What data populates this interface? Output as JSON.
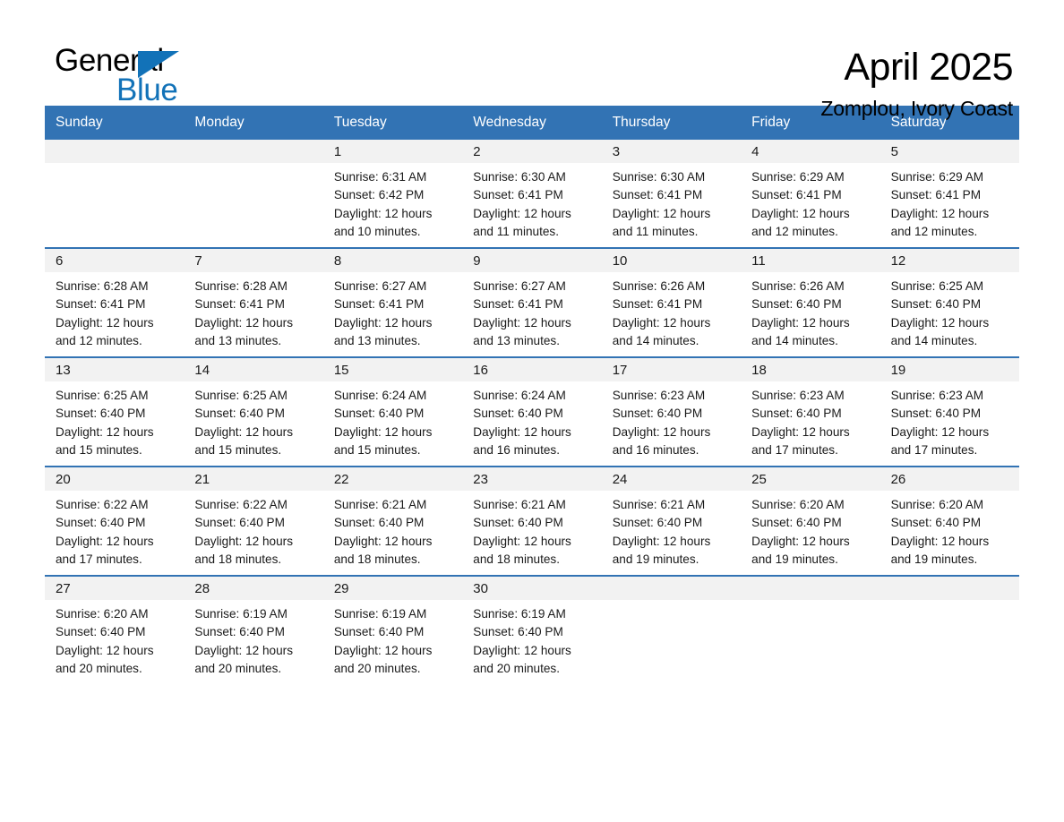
{
  "brand": {
    "name_part1": "General",
    "name_part2": "Blue",
    "logo_icon": "triangle-logo-icon",
    "accent_color": "#1272b8"
  },
  "header": {
    "month_title": "April 2025",
    "location": "Zomplou, Ivory Coast"
  },
  "theme": {
    "header_blue": "#3273b4",
    "daynum_band": "#f2f2f2",
    "text_color": "#1a1a1a"
  },
  "weekdays": [
    "Sunday",
    "Monday",
    "Tuesday",
    "Wednesday",
    "Thursday",
    "Friday",
    "Saturday"
  ],
  "weeks": [
    {
      "days": [
        {
          "daynum": "",
          "sunrise": "",
          "sunset": "",
          "daylight_line1": "",
          "daylight_line2": "",
          "empty": true
        },
        {
          "daynum": "",
          "sunrise": "",
          "sunset": "",
          "daylight_line1": "",
          "daylight_line2": "",
          "empty": true
        },
        {
          "daynum": "1",
          "sunrise": "Sunrise: 6:31 AM",
          "sunset": "Sunset: 6:42 PM",
          "daylight_line1": "Daylight: 12 hours",
          "daylight_line2": "and 10 minutes.",
          "empty": false
        },
        {
          "daynum": "2",
          "sunrise": "Sunrise: 6:30 AM",
          "sunset": "Sunset: 6:41 PM",
          "daylight_line1": "Daylight: 12 hours",
          "daylight_line2": "and 11 minutes.",
          "empty": false
        },
        {
          "daynum": "3",
          "sunrise": "Sunrise: 6:30 AM",
          "sunset": "Sunset: 6:41 PM",
          "daylight_line1": "Daylight: 12 hours",
          "daylight_line2": "and 11 minutes.",
          "empty": false
        },
        {
          "daynum": "4",
          "sunrise": "Sunrise: 6:29 AM",
          "sunset": "Sunset: 6:41 PM",
          "daylight_line1": "Daylight: 12 hours",
          "daylight_line2": "and 12 minutes.",
          "empty": false
        },
        {
          "daynum": "5",
          "sunrise": "Sunrise: 6:29 AM",
          "sunset": "Sunset: 6:41 PM",
          "daylight_line1": "Daylight: 12 hours",
          "daylight_line2": "and 12 minutes.",
          "empty": false
        }
      ]
    },
    {
      "days": [
        {
          "daynum": "6",
          "sunrise": "Sunrise: 6:28 AM",
          "sunset": "Sunset: 6:41 PM",
          "daylight_line1": "Daylight: 12 hours",
          "daylight_line2": "and 12 minutes.",
          "empty": false
        },
        {
          "daynum": "7",
          "sunrise": "Sunrise: 6:28 AM",
          "sunset": "Sunset: 6:41 PM",
          "daylight_line1": "Daylight: 12 hours",
          "daylight_line2": "and 13 minutes.",
          "empty": false
        },
        {
          "daynum": "8",
          "sunrise": "Sunrise: 6:27 AM",
          "sunset": "Sunset: 6:41 PM",
          "daylight_line1": "Daylight: 12 hours",
          "daylight_line2": "and 13 minutes.",
          "empty": false
        },
        {
          "daynum": "9",
          "sunrise": "Sunrise: 6:27 AM",
          "sunset": "Sunset: 6:41 PM",
          "daylight_line1": "Daylight: 12 hours",
          "daylight_line2": "and 13 minutes.",
          "empty": false
        },
        {
          "daynum": "10",
          "sunrise": "Sunrise: 6:26 AM",
          "sunset": "Sunset: 6:41 PM",
          "daylight_line1": "Daylight: 12 hours",
          "daylight_line2": "and 14 minutes.",
          "empty": false
        },
        {
          "daynum": "11",
          "sunrise": "Sunrise: 6:26 AM",
          "sunset": "Sunset: 6:40 PM",
          "daylight_line1": "Daylight: 12 hours",
          "daylight_line2": "and 14 minutes.",
          "empty": false
        },
        {
          "daynum": "12",
          "sunrise": "Sunrise: 6:25 AM",
          "sunset": "Sunset: 6:40 PM",
          "daylight_line1": "Daylight: 12 hours",
          "daylight_line2": "and 14 minutes.",
          "empty": false
        }
      ]
    },
    {
      "days": [
        {
          "daynum": "13",
          "sunrise": "Sunrise: 6:25 AM",
          "sunset": "Sunset: 6:40 PM",
          "daylight_line1": "Daylight: 12 hours",
          "daylight_line2": "and 15 minutes.",
          "empty": false
        },
        {
          "daynum": "14",
          "sunrise": "Sunrise: 6:25 AM",
          "sunset": "Sunset: 6:40 PM",
          "daylight_line1": "Daylight: 12 hours",
          "daylight_line2": "and 15 minutes.",
          "empty": false
        },
        {
          "daynum": "15",
          "sunrise": "Sunrise: 6:24 AM",
          "sunset": "Sunset: 6:40 PM",
          "daylight_line1": "Daylight: 12 hours",
          "daylight_line2": "and 15 minutes.",
          "empty": false
        },
        {
          "daynum": "16",
          "sunrise": "Sunrise: 6:24 AM",
          "sunset": "Sunset: 6:40 PM",
          "daylight_line1": "Daylight: 12 hours",
          "daylight_line2": "and 16 minutes.",
          "empty": false
        },
        {
          "daynum": "17",
          "sunrise": "Sunrise: 6:23 AM",
          "sunset": "Sunset: 6:40 PM",
          "daylight_line1": "Daylight: 12 hours",
          "daylight_line2": "and 16 minutes.",
          "empty": false
        },
        {
          "daynum": "18",
          "sunrise": "Sunrise: 6:23 AM",
          "sunset": "Sunset: 6:40 PM",
          "daylight_line1": "Daylight: 12 hours",
          "daylight_line2": "and 17 minutes.",
          "empty": false
        },
        {
          "daynum": "19",
          "sunrise": "Sunrise: 6:23 AM",
          "sunset": "Sunset: 6:40 PM",
          "daylight_line1": "Daylight: 12 hours",
          "daylight_line2": "and 17 minutes.",
          "empty": false
        }
      ]
    },
    {
      "days": [
        {
          "daynum": "20",
          "sunrise": "Sunrise: 6:22 AM",
          "sunset": "Sunset: 6:40 PM",
          "daylight_line1": "Daylight: 12 hours",
          "daylight_line2": "and 17 minutes.",
          "empty": false
        },
        {
          "daynum": "21",
          "sunrise": "Sunrise: 6:22 AM",
          "sunset": "Sunset: 6:40 PM",
          "daylight_line1": "Daylight: 12 hours",
          "daylight_line2": "and 18 minutes.",
          "empty": false
        },
        {
          "daynum": "22",
          "sunrise": "Sunrise: 6:21 AM",
          "sunset": "Sunset: 6:40 PM",
          "daylight_line1": "Daylight: 12 hours",
          "daylight_line2": "and 18 minutes.",
          "empty": false
        },
        {
          "daynum": "23",
          "sunrise": "Sunrise: 6:21 AM",
          "sunset": "Sunset: 6:40 PM",
          "daylight_line1": "Daylight: 12 hours",
          "daylight_line2": "and 18 minutes.",
          "empty": false
        },
        {
          "daynum": "24",
          "sunrise": "Sunrise: 6:21 AM",
          "sunset": "Sunset: 6:40 PM",
          "daylight_line1": "Daylight: 12 hours",
          "daylight_line2": "and 19 minutes.",
          "empty": false
        },
        {
          "daynum": "25",
          "sunrise": "Sunrise: 6:20 AM",
          "sunset": "Sunset: 6:40 PM",
          "daylight_line1": "Daylight: 12 hours",
          "daylight_line2": "and 19 minutes.",
          "empty": false
        },
        {
          "daynum": "26",
          "sunrise": "Sunrise: 6:20 AM",
          "sunset": "Sunset: 6:40 PM",
          "daylight_line1": "Daylight: 12 hours",
          "daylight_line2": "and 19 minutes.",
          "empty": false
        }
      ]
    },
    {
      "days": [
        {
          "daynum": "27",
          "sunrise": "Sunrise: 6:20 AM",
          "sunset": "Sunset: 6:40 PM",
          "daylight_line1": "Daylight: 12 hours",
          "daylight_line2": "and 20 minutes.",
          "empty": false
        },
        {
          "daynum": "28",
          "sunrise": "Sunrise: 6:19 AM",
          "sunset": "Sunset: 6:40 PM",
          "daylight_line1": "Daylight: 12 hours",
          "daylight_line2": "and 20 minutes.",
          "empty": false
        },
        {
          "daynum": "29",
          "sunrise": "Sunrise: 6:19 AM",
          "sunset": "Sunset: 6:40 PM",
          "daylight_line1": "Daylight: 12 hours",
          "daylight_line2": "and 20 minutes.",
          "empty": false
        },
        {
          "daynum": "30",
          "sunrise": "Sunrise: 6:19 AM",
          "sunset": "Sunset: 6:40 PM",
          "daylight_line1": "Daylight: 12 hours",
          "daylight_line2": "and 20 minutes.",
          "empty": false
        },
        {
          "daynum": "",
          "sunrise": "",
          "sunset": "",
          "daylight_line1": "",
          "daylight_line2": "",
          "empty": true
        },
        {
          "daynum": "",
          "sunrise": "",
          "sunset": "",
          "daylight_line1": "",
          "daylight_line2": "",
          "empty": true
        },
        {
          "daynum": "",
          "sunrise": "",
          "sunset": "",
          "daylight_line1": "",
          "daylight_line2": "",
          "empty": true
        }
      ]
    }
  ]
}
